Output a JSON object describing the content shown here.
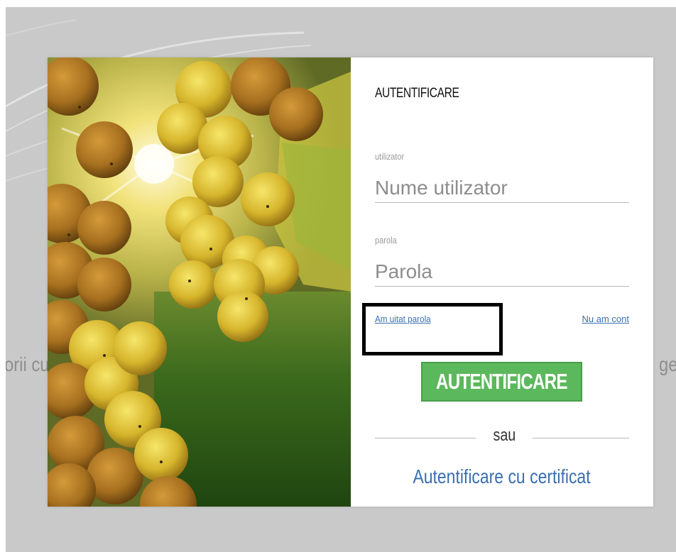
{
  "background": {
    "left_text": "orii cu",
    "right_text": "ge"
  },
  "login": {
    "title": "AUTENTIFICARE",
    "username": {
      "label": "utilizator",
      "placeholder": "Nume utilizator",
      "value": ""
    },
    "password": {
      "label": "parola",
      "placeholder": "Parola",
      "value": ""
    },
    "forgot_password": "Am uitat parola",
    "no_account": "Nu am cont",
    "submit_label": "AUTENTIFICARE",
    "separator": "sau",
    "certificate_link": "Autentificare cu certificat"
  },
  "colors": {
    "backdrop": "#c9c9c9",
    "button_green": "#5cb85c",
    "link_blue": "#3a6fb0",
    "highlight_border": "#000000"
  }
}
